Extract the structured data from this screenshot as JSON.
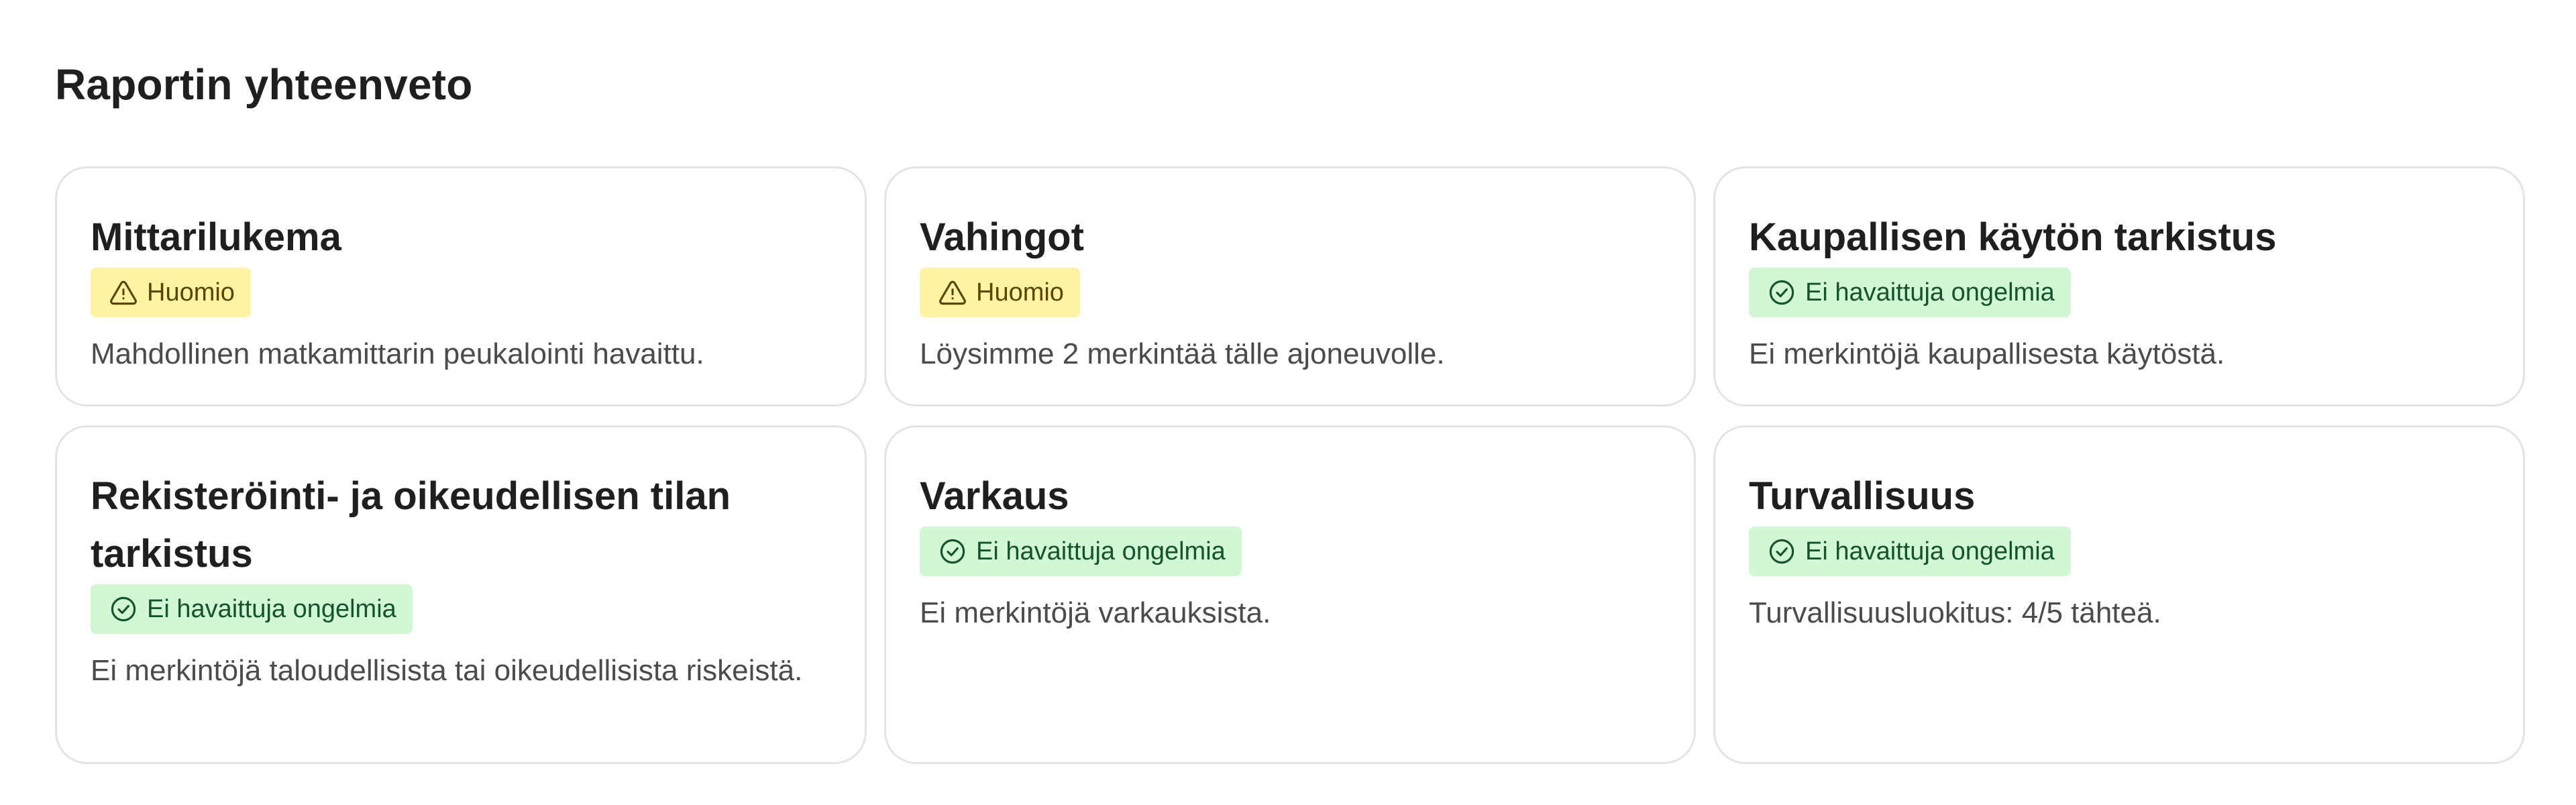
{
  "page": {
    "title": "Raportin yhteenveto"
  },
  "colors": {
    "warning_bg": "#fdf4a3",
    "warning_fg": "#5a4500",
    "ok_bg": "#d1f7d4",
    "ok_fg": "#14532d",
    "card_border": "#e4e4e4"
  },
  "cards": [
    {
      "title": "Mittarilukema",
      "badge": {
        "status": "warning",
        "icon": "warning-triangle-icon",
        "label": "Huomio"
      },
      "text": "Mahdollinen matkamittarin peukalointi havaittu."
    },
    {
      "title": "Vahingot",
      "badge": {
        "status": "warning",
        "icon": "warning-triangle-icon",
        "label": "Huomio"
      },
      "text": "Löysimme 2 merkintää tälle ajoneuvolle."
    },
    {
      "title": "Kaupallisen käytön tarkistus",
      "badge": {
        "status": "ok",
        "icon": "check-circle-icon",
        "label": "Ei havaittuja ongelmia"
      },
      "text": "Ei merkintöjä kaupallisesta käytöstä."
    },
    {
      "title": "Rekisteröinti- ja oikeudellisen tilan tarkistus",
      "badge": {
        "status": "ok",
        "icon": "check-circle-icon",
        "label": "Ei havaittuja ongelmia"
      },
      "text": "Ei merkintöjä taloudellisista tai oikeudellisista riskeistä."
    },
    {
      "title": "Varkaus",
      "badge": {
        "status": "ok",
        "icon": "check-circle-icon",
        "label": "Ei havaittuja ongelmia"
      },
      "text": "Ei merkintöjä varkauksista."
    },
    {
      "title": "Turvallisuus",
      "badge": {
        "status": "ok",
        "icon": "check-circle-icon",
        "label": "Ei havaittuja ongelmia"
      },
      "text": "Turvallisuusluokitus: 4/5 tähteä."
    }
  ]
}
